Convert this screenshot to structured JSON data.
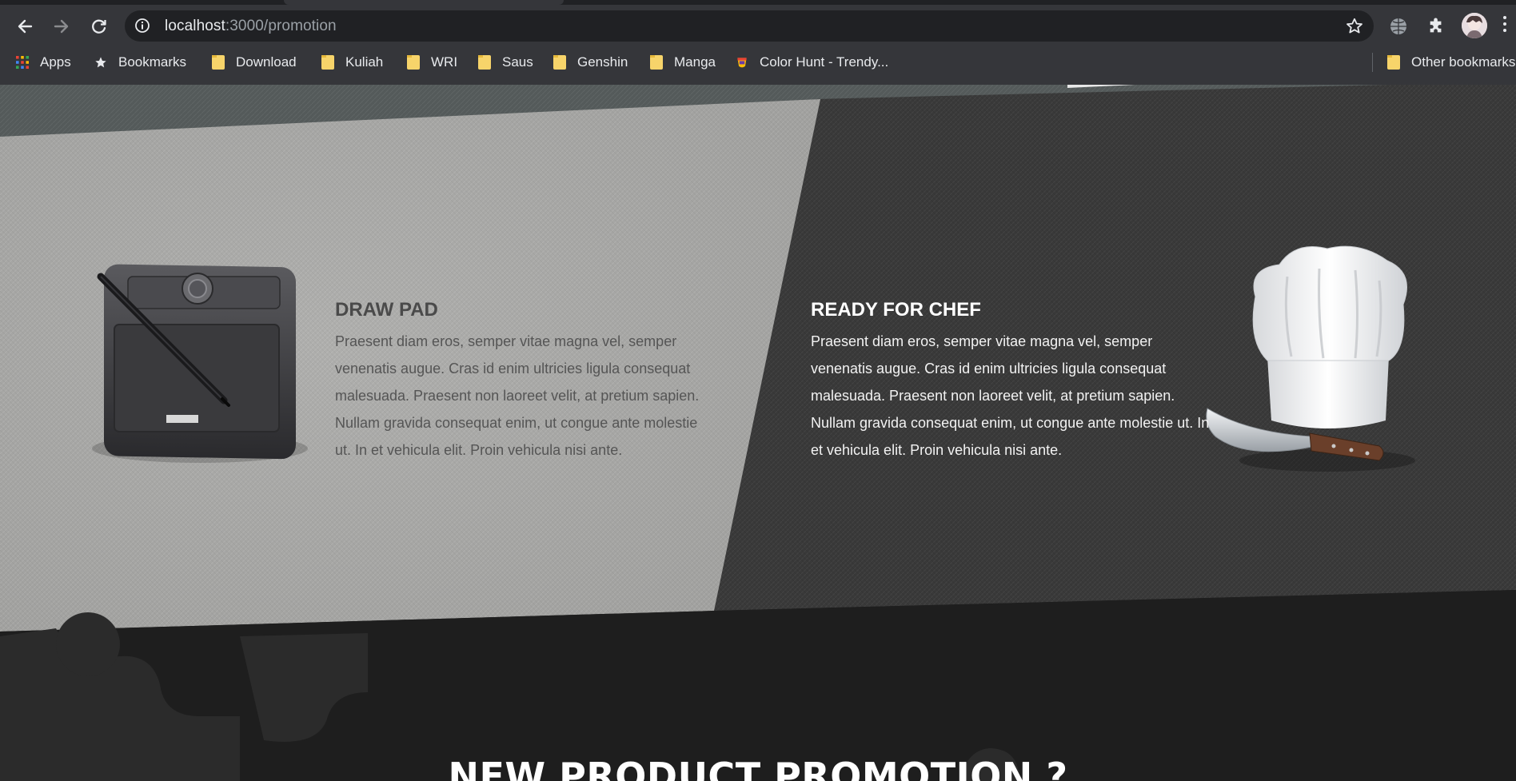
{
  "browser": {
    "url_host": "localhost",
    "url_path": ":3000/promotion",
    "bookmarks": [
      {
        "label": "Apps",
        "icon": "apps-grid-icon"
      },
      {
        "label": "Bookmarks",
        "icon": "star-icon"
      },
      {
        "label": "Download",
        "icon": "folder-icon"
      },
      {
        "label": "Kuliah",
        "icon": "folder-icon"
      },
      {
        "label": "WRI",
        "icon": "folder-icon"
      },
      {
        "label": "Saus",
        "icon": "folder-icon"
      },
      {
        "label": "Genshin",
        "icon": "folder-icon"
      },
      {
        "label": "Manga",
        "icon": "folder-icon"
      },
      {
        "label": "Color Hunt - Trendy...",
        "icon": "colorhunt-icon"
      }
    ],
    "other_bookmarks": "Other bookmarks"
  },
  "features": {
    "draw_pad": {
      "title": "DRAW PAD",
      "text_1": "Praesent diam eros, semper vitae magna vel, semper venenatis augue. Cras id enim ultricies ligula consequat malesuada. Praesent non laoreet velit, at pretium sapien.",
      "text_2": "Nullam gravida consequat enim, ut congue ante molestie ut. In et vehicula elit. Proin vehicula nisi ante."
    },
    "chef": {
      "title": "READY FOR CHEF",
      "text": "Praesent diam eros, semper vitae magna vel, semper venenatis augue. Cras id enim ultricies ligula consequat malesuada. Praesent non laoreet velit, at pretium sapien. Nullam gravida consequat enim, ut congue ante molestie ut. In et vehicula elit. Proin vehicula nisi ante."
    }
  },
  "promo": {
    "title": "NEW PRODUCT PROMOTION ?"
  },
  "colors": {
    "chrome_bg": "#35363a",
    "omnibox_bg": "#202124",
    "light_panel": "#a8a8a6",
    "dark_panel": "#3a3a3a",
    "page_bg": "#1c1c1c"
  }
}
